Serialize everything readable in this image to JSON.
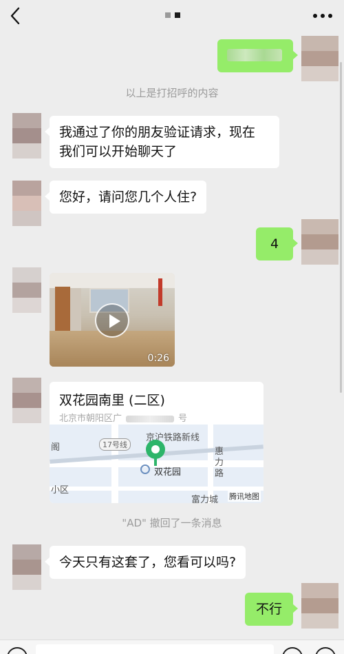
{
  "header": {
    "back_icon": "chevron-left-icon",
    "title_obscured": true,
    "more_icon": "ellipsis-icon"
  },
  "messages": {
    "m1_text_obscured": true,
    "system_greeting": "以上是打招呼的内容",
    "m2_line1": "我通过了你的朋友验证请求，现在",
    "m2_line2": "我们可以开始聊天了",
    "m3": "您好，请问您几个人住?",
    "m4": "4",
    "video_duration": "0:26",
    "location_title": "双花园南里 (二区)",
    "location_addr_start": "北京市朝阳区广",
    "location_addr_end": "号",
    "system_recall": "\"AD\" 撤回了一条消息",
    "m7": "今天只有这套了，您看可以吗?",
    "m8": "不行"
  },
  "map": {
    "label_ge": "阁",
    "line_badge": "17号线",
    "railway": "京沪铁路新线",
    "poi_name": "双花园",
    "road_huili_1": "惠",
    "road_huili_2": "力",
    "road_huili_3": "路",
    "xiaoqu": "小区",
    "fuli": "富力城",
    "brand": "腾讯地图"
  },
  "colors": {
    "background": "#ededed",
    "bubble_self": "#95ec69",
    "bubble_other": "#ffffff",
    "pin": "#2db56a"
  }
}
